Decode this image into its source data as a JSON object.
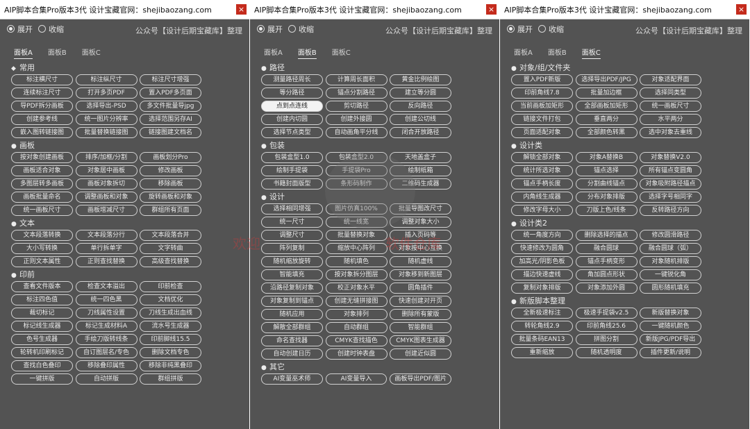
{
  "watermark": {
    "line1": "欢迎　　　　　　　　　软件仓库",
    "line2": ""
  },
  "panels": [
    {
      "title": "AIP脚本合集Pro版本3代 设计宝藏官网：shejibaozang.com",
      "close": "×",
      "radio_expand": "展开",
      "radio_collapse": "收缩",
      "credit": "公众号【设计后期宝藏库】整理",
      "tabs": [
        "面板A",
        "面板B",
        "面板C"
      ],
      "active_tab": 0,
      "sections": [
        {
          "label": "常用",
          "sym": "◆",
          "rows": [
            [
              "标注横尺寸",
              "标注纵尺寸",
              "标注尺寸增强"
            ],
            [
              "连续标注尺寸",
              "打开多页PDF",
              "置入PDF多页面"
            ],
            [
              "导PDF拆分画板",
              "选择导出-PSD",
              "多文件批量导jpg"
            ],
            [
              "创建参考线",
              "统一图片分辨率",
              "选择范围另存AI"
            ],
            [
              "嵌入图转链接图",
              "批量替换链接图",
              "链接图建文档名"
            ]
          ]
        },
        {
          "label": "画板",
          "sym": "●",
          "rows": [
            [
              "按对象创建画板",
              "排序/加框/分割",
              "画板划分Pro"
            ],
            [
              "画板适合对象",
              "对象居中画板",
              "修改画板"
            ],
            [
              "多图层转多画板",
              "画板对象拆切",
              "移除画板"
            ],
            [
              "画板批量命名",
              "调整画板和对象",
              "旋转画板和对象"
            ],
            [
              "统一画板尺寸",
              "画板增减尺寸",
              "群组所有页面"
            ]
          ]
        },
        {
          "label": "文本",
          "sym": "●",
          "rows": [
            [
              "文本段落转换",
              "文本段落分行",
              "文本段落合并"
            ],
            [
              "大小写转换",
              "单行拆单字",
              "文字转曲"
            ],
            [
              "正则文本属性",
              "正则查找替换",
              "高级查找替换"
            ]
          ]
        },
        {
          "label": "印前",
          "sym": "●",
          "rows": [
            [
              "查看文件版本",
              "检查文本溢出",
              "印前检查"
            ],
            [
              "标注四色值",
              "统一四色黑",
              "文档优化"
            ],
            [
              "裁切标记",
              "刀线属性设置",
              "刀线生成出血线"
            ],
            [
              "标记线生成器",
              "标记生成材料A",
              "流水号生成器"
            ],
            [
              "色号生成器",
              "手绘刀版转线条",
              "印前脚线15.5"
            ],
            [
              "轮转机印刷标记",
              "自订图层名/专色",
              "删除文档专色"
            ],
            [
              "查找白色叠印",
              "移除叠印属性",
              "移除非纯黑叠印"
            ],
            [
              "一键拼版",
              "自动拼版",
              "群组拼版"
            ]
          ]
        }
      ]
    },
    {
      "title": "AIP脚本合集Pro版本3代 设计宝藏官网：shejibaozang.com",
      "close": "×",
      "radio_expand": "展开",
      "radio_collapse": "收缩",
      "credit": "公众号【设计后期宝藏库】整理",
      "tabs": [
        "面板A",
        "面板B",
        "面板C"
      ],
      "active_tab": 1,
      "sections": [
        {
          "label": "路径",
          "sym": "●",
          "rows": [
            [
              "测量路径周长",
              "计算周长面积",
              "黄金比例绘图"
            ],
            [
              "等分路径",
              "锚点分割路径",
              "建立等分圆"
            ],
            [
              "点到点连线",
              "剪切路径",
              "反向路径"
            ],
            [
              "创建内切圆",
              "创建外接圆",
              "创建公切线"
            ],
            [
              "选择节点类型",
              "自动画角平分线",
              "闭合开放路径"
            ]
          ]
        },
        {
          "label": "包装",
          "sym": "●",
          "rows": [
            [
              "包装盒型1.0",
              "包装盒型2.0",
              "天地盖盒子"
            ],
            [
              "绘制手提袋",
              "手提袋Pro",
              "绘制纸箱"
            ],
            [
              "书籍封面版型",
              "条形码制作",
              "二维码生成器"
            ]
          ]
        },
        {
          "label": "设计",
          "sym": "●",
          "rows": [
            [
              "选择相同增强",
              "图片仿真100%",
              "批量导图改尺寸"
            ],
            [
              "统一尺寸",
              "统一线宽",
              "调整对象大小"
            ],
            [
              "调整尺寸",
              "批量替换对象",
              "插入页码等"
            ],
            [
              "阵列复制",
              "缩放中心阵列",
              "对象按中心互换"
            ],
            [
              "随机缩放旋转",
              "随机填色",
              "随机虚线"
            ],
            [
              "智能填充",
              "按对象拆分图层",
              "对象移到新图层"
            ],
            [
              "沿路径复制对象",
              "校正对象水平",
              "圆角插件"
            ],
            [
              "对象复制到锚点",
              "创建无缝拼接图",
              "快速创建对开页"
            ],
            [
              "随机应用",
              "对象排列",
              "删除所有蒙版"
            ],
            [
              "解散全部群组",
              "自动群组",
              "智能群组"
            ],
            [
              "命名查找器",
              "CMYK查找描色",
              "CMYK图表生成器"
            ],
            [
              "自动创建日历",
              "创建时钟表盘",
              "创建近似圆"
            ]
          ]
        },
        {
          "label": "其它",
          "sym": "●",
          "rows2": [
            [
              "AI变量巫术师",
              "AI变量导入",
              "画板导出PDF/图片"
            ]
          ]
        }
      ]
    },
    {
      "title": "AIP脚本合集Pro版本3代 设计宝藏官网：shejibaozang.com",
      "close": "×",
      "radio_expand": "展开",
      "radio_collapse": "收缩",
      "credit": "公众号【设计后期宝藏库】整理",
      "tabs": [
        "面板A",
        "面板B",
        "面板C"
      ],
      "active_tab": 2,
      "sections": [
        {
          "label": "对象/组/文件夹",
          "sym": "●",
          "rows": [
            [
              "置入PDF新版",
              "选择导出PDF/JPG",
              "对象适配界面"
            ],
            [
              "印前角线7.8",
              "批量加边框",
              "选择同类型"
            ],
            [
              "当前画板加矩形",
              "全部画板加矩形",
              "统一画板尺寸"
            ],
            [
              "链接文件打包",
              "垂直两分",
              "水平两分"
            ],
            [
              "页面适配对象",
              "全部颜色转黑",
              "选中对象去重线"
            ]
          ]
        },
        {
          "label": "设计类",
          "sym": "●",
          "rows": [
            [
              "解锁全部对象",
              "对象A替换B",
              "对象替换V2.0"
            ],
            [
              "统计所选对象",
              "锚点选择",
              "所有锚点变圆角"
            ],
            [
              "锚点手柄长度",
              "分割曲线锚点",
              "对象吸附路径描点"
            ],
            [
              "内角线生成器",
              "分布对象排版",
              "选择字号相同字"
            ],
            [
              "修改字母大小",
              "刀版上色/线条",
              "反转路径方向"
            ]
          ]
        },
        {
          "label": "设计类2",
          "sym": "●",
          "rows": [
            [
              "统一角度方向",
              "删除选择的描点",
              "修改圆滑路径"
            ],
            [
              "快速修改为圆角",
              "融合圆球",
              "融合圆球（弧）"
            ],
            [
              "加高光/阴影色板",
              "锚点手柄变形",
              "对象随机排版"
            ],
            [
              "描边快速虚线",
              "角加圆点形状",
              "一键锐化角"
            ],
            [
              "复制对象排版",
              "对象添加外圆",
              "圆形随机填充"
            ]
          ]
        },
        {
          "label": "新版脚本整理",
          "sym": "●",
          "rows": [
            [
              "全新极速标注",
              "极速手提袋v2.5",
              "新版替换对象"
            ],
            [
              "转轮角线2.9",
              "印前角线25.6",
              "一键随机颜色"
            ],
            [
              "批量条码EAN13",
              "拼图分割",
              "新版JPG/PDF导出"
            ],
            [
              "重新缩放",
              "随机透明度",
              "插件更新/说明"
            ]
          ]
        }
      ]
    }
  ]
}
